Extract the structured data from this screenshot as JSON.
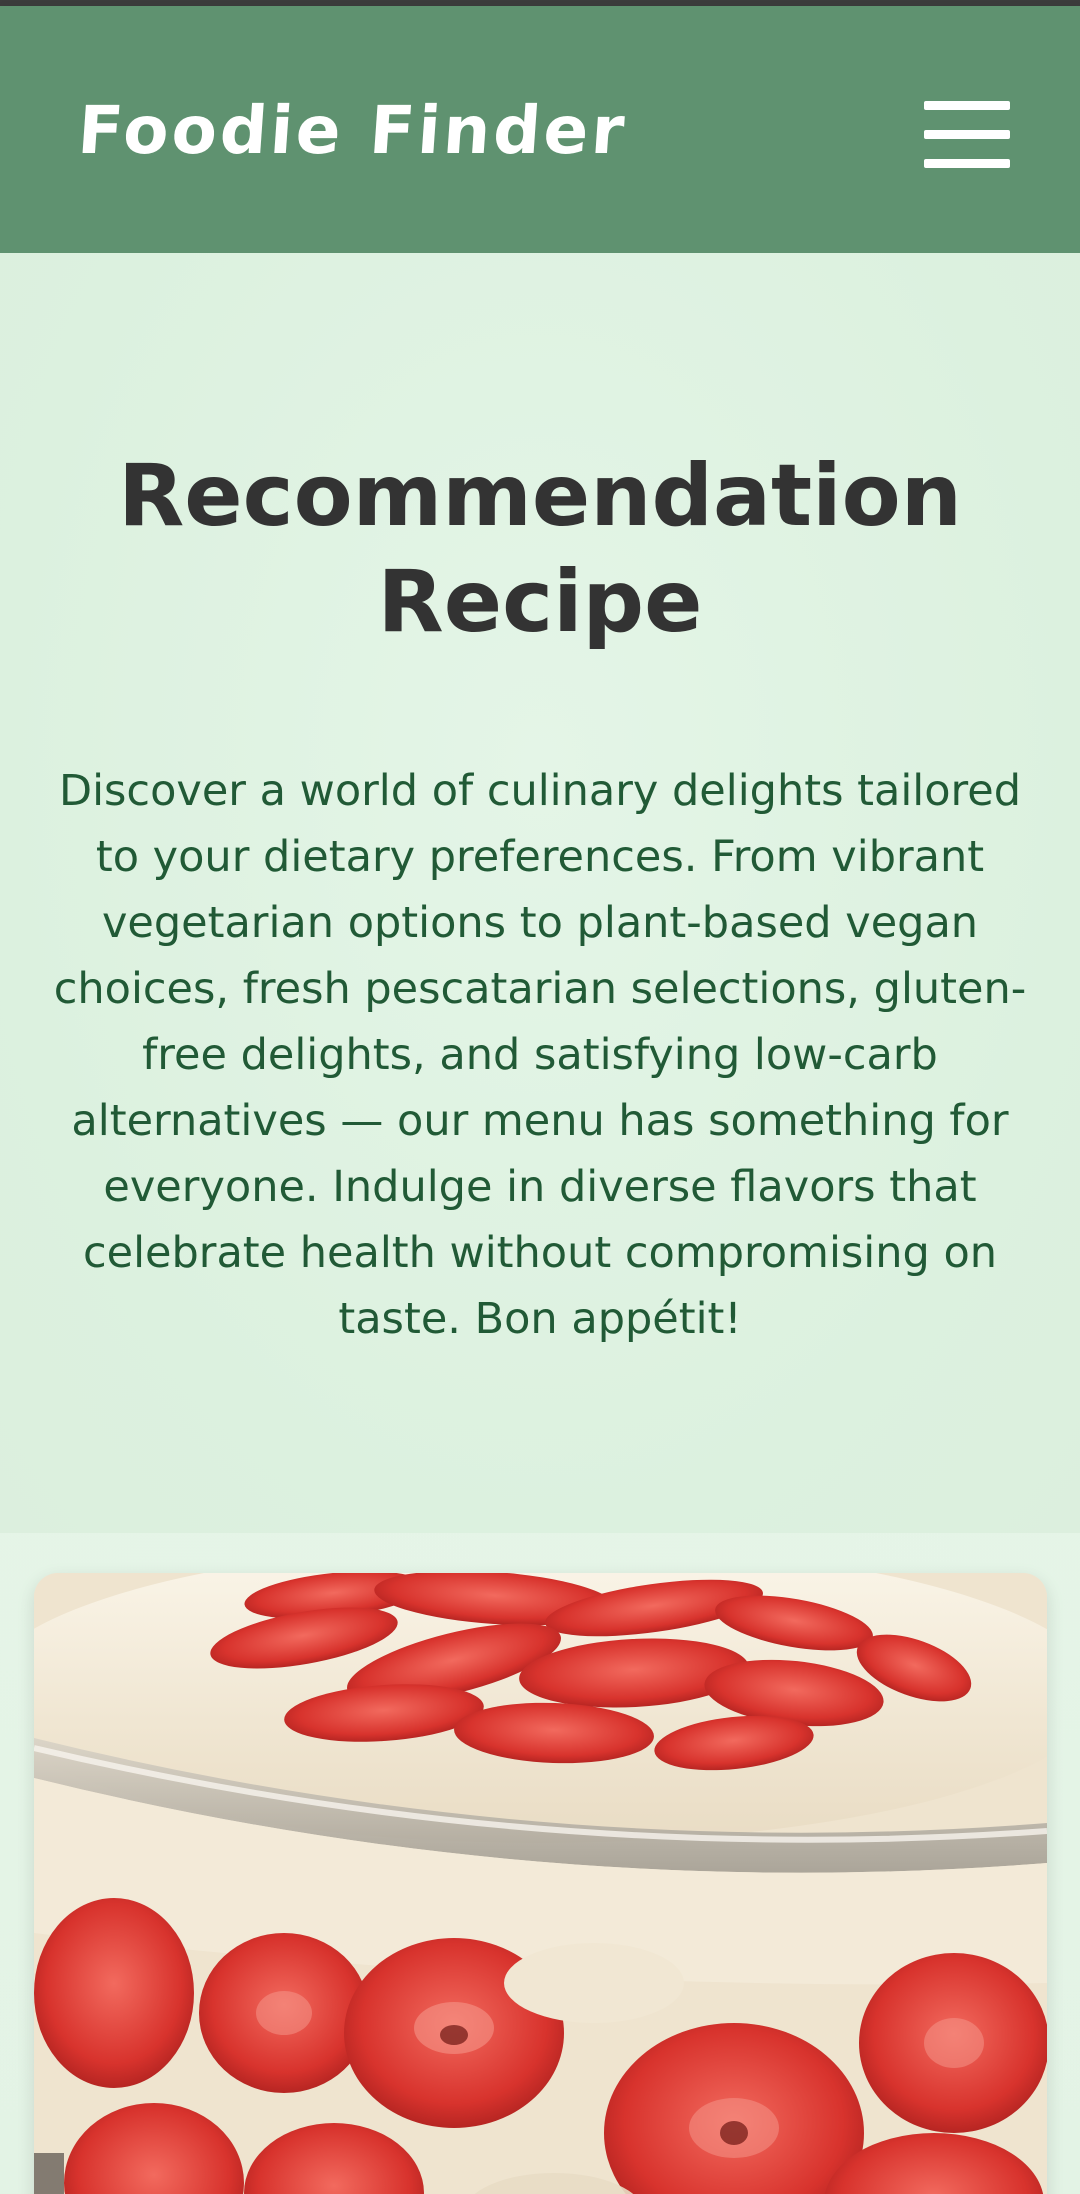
{
  "header": {
    "brand": "Foodie Finder",
    "menu_icon": "hamburger-menu-icon"
  },
  "hero": {
    "title": "Recommendation Recipe",
    "description": "Discover a world of culinary delights tailored to your dietary preferences. From vibrant vegetarian options to plant-based vegan choices, fresh pescatarian selections, gluten-free delights, and satisfying low-carb alternatives — our menu has something for everyone. Indulge in diverse flavors that celebrate health without compromising on taste. Bon appétit!"
  },
  "colors": {
    "header_bg": "#5f9270",
    "page_bg": "#dff3e2",
    "title": "#333333",
    "body_text": "#215a36"
  }
}
